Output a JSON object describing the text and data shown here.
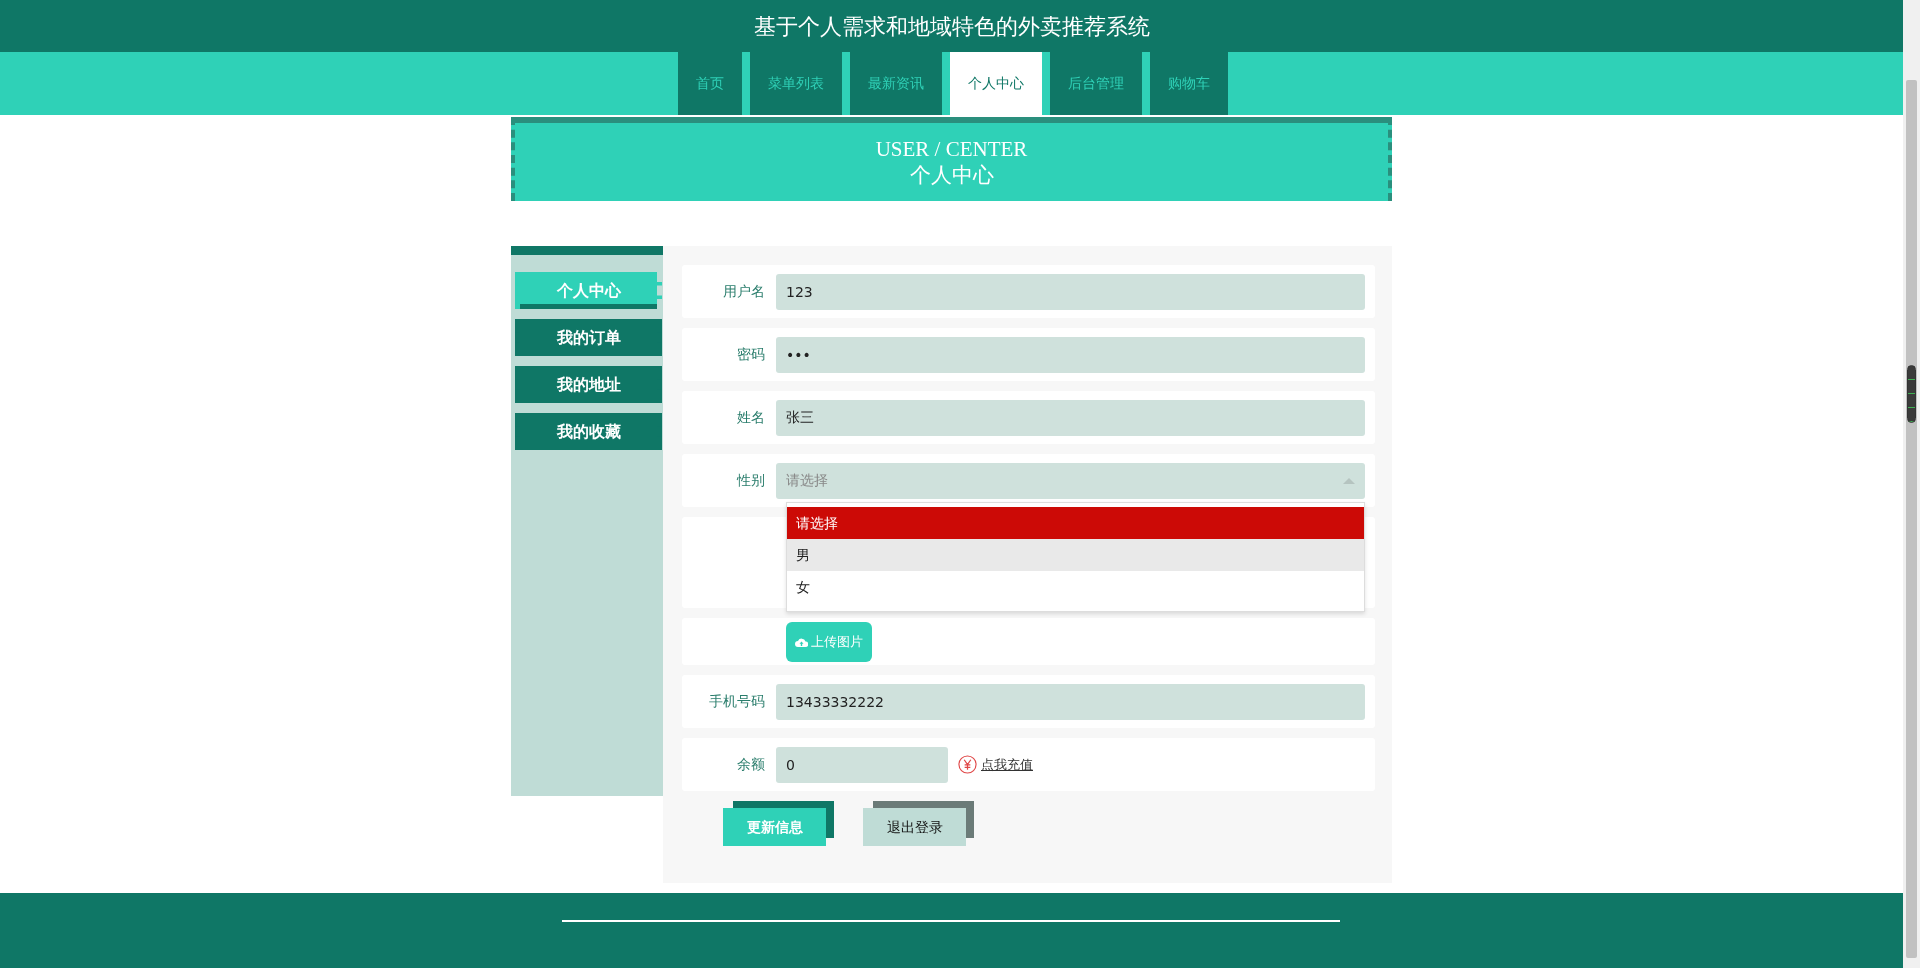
{
  "header": {
    "title": "基于个人需求和地域特色的外卖推荐系统"
  },
  "nav": [
    {
      "label": "首页",
      "selected": false
    },
    {
      "label": "菜单列表",
      "selected": false
    },
    {
      "label": "最新资讯",
      "selected": false
    },
    {
      "label": "个人中心",
      "selected": true
    },
    {
      "label": "后台管理",
      "selected": false
    },
    {
      "label": "购物车",
      "selected": false
    }
  ],
  "banner": {
    "title_en": "USER / CENTER",
    "title_cn": "个人中心"
  },
  "sidebar": {
    "items": [
      {
        "label": "个人中心",
        "selected": true
      },
      {
        "label": "我的订单",
        "selected": false
      },
      {
        "label": "我的地址",
        "selected": false
      },
      {
        "label": "我的收藏",
        "selected": false
      }
    ]
  },
  "form": {
    "rows": [
      {
        "kind": "text",
        "label": "用户名",
        "value": "123"
      },
      {
        "kind": "text",
        "label": "密码",
        "value": "•••"
      },
      {
        "kind": "text",
        "label": "姓名",
        "value": "张三"
      },
      {
        "kind": "select",
        "label": "性别",
        "placeholder": "请选择",
        "expanded": true,
        "options": [
          {
            "label": "请选择",
            "selected": true,
            "hovered": false
          },
          {
            "label": "男",
            "selected": false,
            "hovered": true
          },
          {
            "label": "女",
            "selected": false,
            "hovered": false
          }
        ]
      },
      {
        "kind": "blank"
      },
      {
        "kind": "upload",
        "button": "上传图片"
      },
      {
        "kind": "text",
        "label": "手机号码",
        "value": "13433332222"
      },
      {
        "kind": "balance",
        "label": "余额",
        "value": "0",
        "link": "点我充值"
      }
    ],
    "buttons": [
      {
        "kind": "primary",
        "label": "更新信息"
      },
      {
        "kind": "secondary",
        "label": "退出登录"
      }
    ]
  }
}
